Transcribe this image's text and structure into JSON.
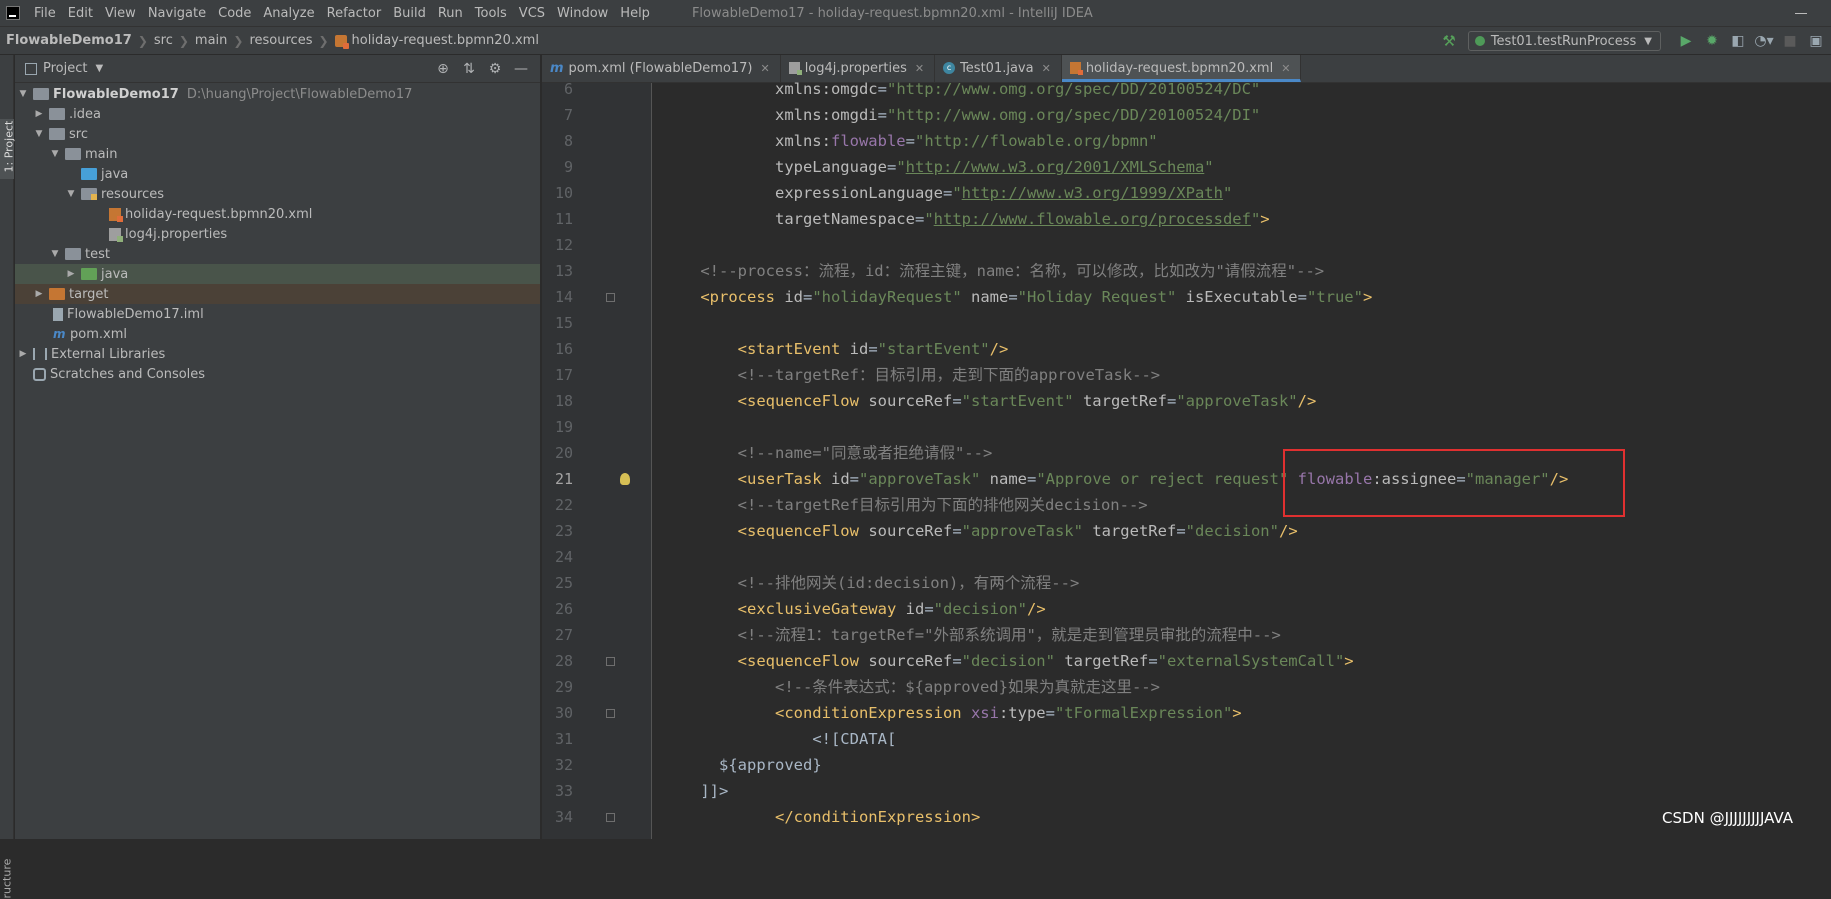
{
  "menubar": {
    "items": [
      "File",
      "Edit",
      "View",
      "Navigate",
      "Code",
      "Analyze",
      "Refactor",
      "Build",
      "Run",
      "Tools",
      "VCS",
      "Window",
      "Help"
    ],
    "window_title": "FlowableDemo17 - holiday-request.bpmn20.xml - IntelliJ IDEA"
  },
  "navbar": {
    "breadcrumbs": [
      "FlowableDemo17",
      "src",
      "main",
      "resources",
      "holiday-request.bpmn20.xml"
    ],
    "run_config": "Test01.testRunProcess"
  },
  "sidebar": {
    "tab_project": "1: Project",
    "tab_structure": "ructure"
  },
  "project_panel": {
    "title": "Project",
    "tree": [
      {
        "label": "FlowableDemo17",
        "hint": "D:\\huang\\Project\\FlowableDemo17"
      },
      {
        "label": ".idea"
      },
      {
        "label": "src"
      },
      {
        "label": "main"
      },
      {
        "label": "java"
      },
      {
        "label": "resources"
      },
      {
        "label": "holiday-request.bpmn20.xml"
      },
      {
        "label": "log4j.properties"
      },
      {
        "label": "test"
      },
      {
        "label": "java"
      },
      {
        "label": "target"
      },
      {
        "label": "FlowableDemo17.iml"
      },
      {
        "label": "pom.xml"
      },
      {
        "label": "External Libraries"
      },
      {
        "label": "Scratches and Consoles"
      }
    ]
  },
  "editor": {
    "tabs": [
      {
        "label": "pom.xml (FlowableDemo17)"
      },
      {
        "label": "log4j.properties"
      },
      {
        "label": "Test01.java"
      },
      {
        "label": "holiday-request.bpmn20.xml"
      }
    ],
    "current_line": 21,
    "lines": [
      {
        "n": "6",
        "segs": [
          {
            "t": "            ",
            "c": ""
          },
          {
            "t": "xmlns:omgdc",
            "c": "att"
          },
          {
            "t": "=",
            "c": "txt"
          },
          {
            "t": "\"http://www.omg.org/spec/DD/20100524/DC\"",
            "c": "val"
          }
        ]
      },
      {
        "n": "7",
        "segs": [
          {
            "t": "            ",
            "c": ""
          },
          {
            "t": "xmlns:omgdi",
            "c": "att"
          },
          {
            "t": "=",
            "c": "txt"
          },
          {
            "t": "\"http://www.omg.org/spec/DD/20100524/DI\"",
            "c": "val"
          }
        ]
      },
      {
        "n": "8",
        "segs": [
          {
            "t": "            ",
            "c": ""
          },
          {
            "t": "xmlns:",
            "c": "att"
          },
          {
            "t": "flowable",
            "c": "ns"
          },
          {
            "t": "=",
            "c": "txt"
          },
          {
            "t": "\"http://flowable.org/bpmn\"",
            "c": "val"
          }
        ]
      },
      {
        "n": "9",
        "segs": [
          {
            "t": "            ",
            "c": ""
          },
          {
            "t": "typeLanguage",
            "c": "att"
          },
          {
            "t": "=",
            "c": "txt"
          },
          {
            "t": "\"",
            "c": "val"
          },
          {
            "t": "http://www.w3.org/2001/XMLSchema",
            "c": "url"
          },
          {
            "t": "\"",
            "c": "val"
          }
        ]
      },
      {
        "n": "10",
        "segs": [
          {
            "t": "            ",
            "c": ""
          },
          {
            "t": "expressionLanguage",
            "c": "att"
          },
          {
            "t": "=",
            "c": "txt"
          },
          {
            "t": "\"",
            "c": "val"
          },
          {
            "t": "http://www.w3.org/1999/XPath",
            "c": "url"
          },
          {
            "t": "\"",
            "c": "val"
          }
        ]
      },
      {
        "n": "11",
        "segs": [
          {
            "t": "            ",
            "c": ""
          },
          {
            "t": "targetNamespace",
            "c": "att"
          },
          {
            "t": "=",
            "c": "txt"
          },
          {
            "t": "\"",
            "c": "val"
          },
          {
            "t": "http://www.flowable.org/processdef",
            "c": "url"
          },
          {
            "t": "\"",
            "c": "val"
          },
          {
            "t": ">",
            "c": "tag"
          }
        ]
      },
      {
        "n": "12",
        "segs": []
      },
      {
        "n": "13",
        "segs": [
          {
            "t": "    ",
            "c": ""
          },
          {
            "t": "<!--process：流程，id：流程主键，name：名称，可以修改，比如改为\"请假流程\"-->",
            "c": "cmt"
          }
        ]
      },
      {
        "n": "14",
        "fold": true,
        "segs": [
          {
            "t": "    ",
            "c": ""
          },
          {
            "t": "<process ",
            "c": "tag"
          },
          {
            "t": "id",
            "c": "att"
          },
          {
            "t": "=",
            "c": "txt"
          },
          {
            "t": "\"holidayRequest\"",
            "c": "val"
          },
          {
            "t": " name",
            "c": "att"
          },
          {
            "t": "=",
            "c": "txt"
          },
          {
            "t": "\"Holiday Request\"",
            "c": "val"
          },
          {
            "t": " isExecutable",
            "c": "att"
          },
          {
            "t": "=",
            "c": "txt"
          },
          {
            "t": "\"true\"",
            "c": "val"
          },
          {
            "t": ">",
            "c": "tag"
          }
        ]
      },
      {
        "n": "15",
        "segs": []
      },
      {
        "n": "16",
        "segs": [
          {
            "t": "        ",
            "c": ""
          },
          {
            "t": "<startEvent ",
            "c": "tag"
          },
          {
            "t": "id",
            "c": "att"
          },
          {
            "t": "=",
            "c": "txt"
          },
          {
            "t": "\"startEvent\"",
            "c": "val"
          },
          {
            "t": "/>",
            "c": "tag"
          }
        ]
      },
      {
        "n": "17",
        "segs": [
          {
            "t": "        ",
            "c": ""
          },
          {
            "t": "<!--targetRef：目标引用，走到下面的approveTask-->",
            "c": "cmt"
          }
        ]
      },
      {
        "n": "18",
        "segs": [
          {
            "t": "        ",
            "c": ""
          },
          {
            "t": "<sequenceFlow ",
            "c": "tag"
          },
          {
            "t": "sourceRef",
            "c": "att"
          },
          {
            "t": "=",
            "c": "txt"
          },
          {
            "t": "\"startEvent\"",
            "c": "val"
          },
          {
            "t": " targetRef",
            "c": "att"
          },
          {
            "t": "=",
            "c": "txt"
          },
          {
            "t": "\"approveTask\"",
            "c": "val"
          },
          {
            "t": "/>",
            "c": "tag"
          }
        ]
      },
      {
        "n": "19",
        "segs": []
      },
      {
        "n": "20",
        "segs": [
          {
            "t": "        ",
            "c": ""
          },
          {
            "t": "<!--name=\"同意或者拒绝请假\"-->",
            "c": "cmt"
          }
        ]
      },
      {
        "n": "21",
        "bulb": true,
        "segs": [
          {
            "t": "        ",
            "c": ""
          },
          {
            "t": "<userTask ",
            "c": "tag"
          },
          {
            "t": "id",
            "c": "att"
          },
          {
            "t": "=",
            "c": "txt"
          },
          {
            "t": "\"approveTask\"",
            "c": "val"
          },
          {
            "t": " name",
            "c": "att"
          },
          {
            "t": "=",
            "c": "txt"
          },
          {
            "t": "\"Approve or reject request\"",
            "c": "val"
          },
          {
            "t": " ",
            "c": ""
          },
          {
            "t": "flowable",
            "c": "ns"
          },
          {
            "t": ":assignee",
            "c": "att"
          },
          {
            "t": "=",
            "c": "txt"
          },
          {
            "t": "\"manager\"",
            "c": "val"
          },
          {
            "t": "/>",
            "c": "tag"
          }
        ]
      },
      {
        "n": "22",
        "segs": [
          {
            "t": "        ",
            "c": ""
          },
          {
            "t": "<!--targetRef目标引用为下面的排他网关decision-->",
            "c": "cmt"
          }
        ]
      },
      {
        "n": "23",
        "segs": [
          {
            "t": "        ",
            "c": ""
          },
          {
            "t": "<sequenceFlow ",
            "c": "tag"
          },
          {
            "t": "sourceRef",
            "c": "att"
          },
          {
            "t": "=",
            "c": "txt"
          },
          {
            "t": "\"approveTask\"",
            "c": "val"
          },
          {
            "t": " targetRef",
            "c": "att"
          },
          {
            "t": "=",
            "c": "txt"
          },
          {
            "t": "\"decision\"",
            "c": "val"
          },
          {
            "t": "/>",
            "c": "tag"
          }
        ]
      },
      {
        "n": "24",
        "segs": []
      },
      {
        "n": "25",
        "segs": [
          {
            "t": "        ",
            "c": ""
          },
          {
            "t": "<!--排他网关(id:decision)，有两个流程-->",
            "c": "cmt"
          }
        ]
      },
      {
        "n": "26",
        "segs": [
          {
            "t": "        ",
            "c": ""
          },
          {
            "t": "<exclusiveGateway ",
            "c": "tag"
          },
          {
            "t": "id",
            "c": "att"
          },
          {
            "t": "=",
            "c": "txt"
          },
          {
            "t": "\"decision\"",
            "c": "val"
          },
          {
            "t": "/>",
            "c": "tag"
          }
        ]
      },
      {
        "n": "27",
        "segs": [
          {
            "t": "        ",
            "c": ""
          },
          {
            "t": "<!--流程1：targetRef=\"外部系统调用\"，就是走到管理员审批的流程中-->",
            "c": "cmt"
          }
        ]
      },
      {
        "n": "28",
        "fold": true,
        "segs": [
          {
            "t": "        ",
            "c": ""
          },
          {
            "t": "<sequenceFlow ",
            "c": "tag"
          },
          {
            "t": "sourceRef",
            "c": "att"
          },
          {
            "t": "=",
            "c": "txt"
          },
          {
            "t": "\"decision\"",
            "c": "val"
          },
          {
            "t": " targetRef",
            "c": "att"
          },
          {
            "t": "=",
            "c": "txt"
          },
          {
            "t": "\"externalSystemCall\"",
            "c": "val"
          },
          {
            "t": ">",
            "c": "tag"
          }
        ]
      },
      {
        "n": "29",
        "segs": [
          {
            "t": "            ",
            "c": ""
          },
          {
            "t": "<!--条件表达式：${approved}如果为真就走这里-->",
            "c": "cmt"
          }
        ]
      },
      {
        "n": "30",
        "fold": true,
        "segs": [
          {
            "t": "            ",
            "c": ""
          },
          {
            "t": "<conditionExpression ",
            "c": "tag"
          },
          {
            "t": "xsi",
            "c": "ns"
          },
          {
            "t": ":type",
            "c": "att"
          },
          {
            "t": "=",
            "c": "txt"
          },
          {
            "t": "\"tFormalExpression\"",
            "c": "val"
          },
          {
            "t": ">",
            "c": "tag"
          }
        ]
      },
      {
        "n": "31",
        "segs": [
          {
            "t": "                ",
            "c": ""
          },
          {
            "t": "<![CDATA[",
            "c": "txt"
          }
        ]
      },
      {
        "n": "32",
        "segs": [
          {
            "t": "      ",
            "c": ""
          },
          {
            "t": "${approved}",
            "c": "txt"
          }
        ]
      },
      {
        "n": "33",
        "segs": [
          {
            "t": "    ",
            "c": ""
          },
          {
            "t": "]]>",
            "c": "txt"
          }
        ]
      },
      {
        "n": "34",
        "fold": true,
        "segs": [
          {
            "t": "            ",
            "c": ""
          },
          {
            "t": "</conditionExpression>",
            "c": "tag"
          }
        ]
      }
    ]
  },
  "watermark": "CSDN @JJJJJJJJJAVA",
  "colors": {
    "tag": "#e8bf6a",
    "attr": "#bababa",
    "value": "#6a8759",
    "comment": "#808080",
    "namespace": "#9876aa",
    "highlight_box": "#e03030"
  }
}
